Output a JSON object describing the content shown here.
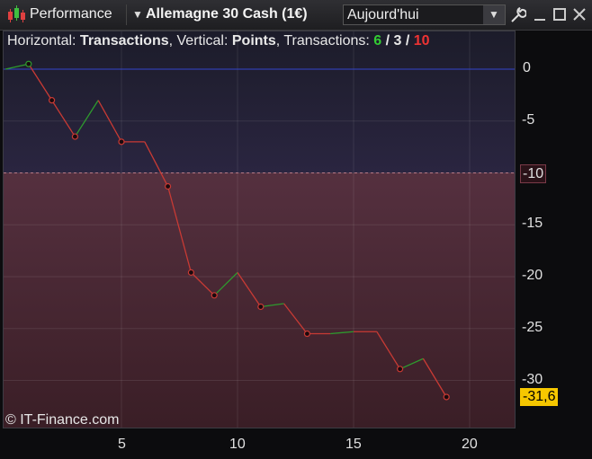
{
  "toolbar": {
    "performance_label": "Performance",
    "instrument_label": "Allemagne 30 Cash (1€)",
    "period_label": "Aujourd'hui",
    "icons": [
      "candlestick-icon",
      "chevron-down-icon",
      "wrench-icon",
      "minimize-icon",
      "maximize-icon",
      "close-icon"
    ]
  },
  "info": {
    "horizontal_key": "Horizontal: ",
    "horizontal_val": "Transactions",
    "sep": ", ",
    "vertical_key": "Vertical: ",
    "vertical_val": "Points",
    "trans_key": ", Transactions: ",
    "wins": "6",
    "slash1": " / ",
    "neutral": "3",
    "slash2": " / ",
    "losses": "10"
  },
  "copyright": "© IT-Finance.com",
  "threshold_label": "-10",
  "last_value_label": "-31,6",
  "colors": {
    "up": "#2e9a2e",
    "down": "#c83a34",
    "zero_line": "#3344cc",
    "badge": "#f6c700"
  },
  "chart_data": {
    "type": "line",
    "xlabel": "",
    "ylabel": "",
    "xlim": [
      0,
      22
    ],
    "ylim": [
      -34.5,
      3.2
    ],
    "x_ticks": [
      "5",
      "10",
      "15",
      "20"
    ],
    "y_ticks": [
      "0",
      "-5",
      "-10",
      "-15",
      "-20",
      "-25",
      "-30"
    ],
    "threshold": -10,
    "points": [
      {
        "x": 0,
        "y": 0
      },
      {
        "x": 1,
        "y": 0.5
      },
      {
        "x": 2,
        "y": -3.0
      },
      {
        "x": 3,
        "y": -6.5
      },
      {
        "x": 4,
        "y": -3.0
      },
      {
        "x": 5,
        "y": -7.0
      },
      {
        "x": 6,
        "y": -7.0
      },
      {
        "x": 7,
        "y": -11.3
      },
      {
        "x": 8,
        "y": -19.6
      },
      {
        "x": 9,
        "y": -21.8
      },
      {
        "x": 10,
        "y": -19.6
      },
      {
        "x": 11,
        "y": -22.9
      },
      {
        "x": 12,
        "y": -22.6
      },
      {
        "x": 13,
        "y": -25.5
      },
      {
        "x": 14,
        "y": -25.5
      },
      {
        "x": 15,
        "y": -25.3
      },
      {
        "x": 16,
        "y": -25.3
      },
      {
        "x": 17,
        "y": -28.9
      },
      {
        "x": 18,
        "y": -27.9
      },
      {
        "x": 19,
        "y": -31.6
      }
    ]
  }
}
